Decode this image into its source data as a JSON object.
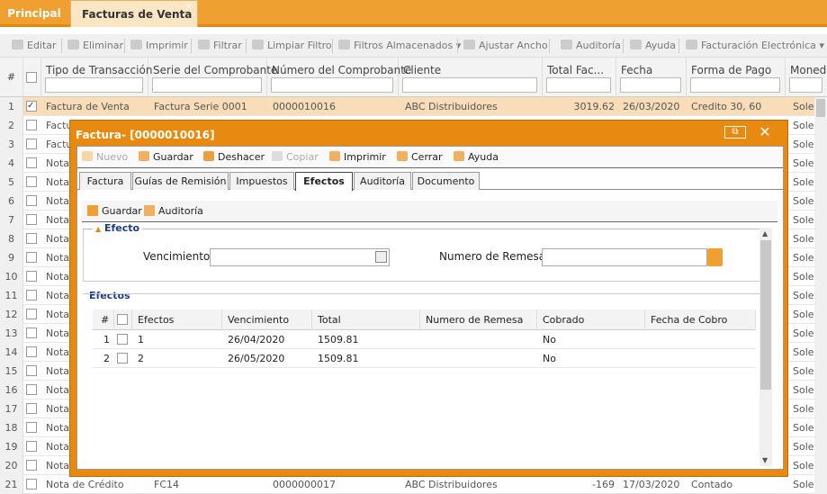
{
  "app_tabs": {
    "principal": "Principal",
    "facturas": "Facturas de Venta",
    "close": "×"
  },
  "toolbar": {
    "editar": "Editar",
    "eliminar": "Eliminar",
    "imprimir": "Imprimir",
    "filtrar": "Filtrar",
    "limpiar_filtro": "Limpiar Filtro",
    "filtros_almacenados": "Filtros Almacenados",
    "ajustar_ancho": "Ajustar Ancho",
    "auditoria": "Auditoría",
    "ayuda": "Ayuda",
    "facturacion_electronica": "Facturación Electrónica"
  },
  "grid": {
    "num_header": "#",
    "columns": [
      "Tipo de Transacción",
      "Serie del Comprobante",
      "Número del Comprobante",
      "Cliente",
      "Total Fac...",
      "Fecha",
      "Forma de Pago",
      "Moneda"
    ],
    "rows": [
      {
        "n": "1",
        "tipo": "Factura de Venta",
        "serie": "Factura Serie 0001",
        "numero": "0000010016",
        "cliente": "ABC Distribuidores",
        "total": "3019.62",
        "fecha": "26/03/2020",
        "forma": "Credito 30, 60",
        "moneda": "Soles",
        "checked": true
      },
      {
        "n": "2",
        "tipo": "Factu",
        "serie": "",
        "numero": "",
        "cliente": "",
        "total": "",
        "fecha": "",
        "forma": "",
        "moneda": "Soles",
        "checked": false
      },
      {
        "n": "3",
        "tipo": "Factu",
        "serie": "",
        "numero": "",
        "cliente": "",
        "total": "",
        "fecha": "",
        "forma": "",
        "moneda": "Soles",
        "checked": false
      },
      {
        "n": "4",
        "tipo": "Nota",
        "serie": "",
        "numero": "",
        "cliente": "",
        "total": "",
        "fecha": "",
        "forma": "",
        "moneda": "Soles",
        "checked": false
      },
      {
        "n": "5",
        "tipo": "Nota",
        "serie": "",
        "numero": "",
        "cliente": "",
        "total": "",
        "fecha": "",
        "forma": "",
        "moneda": "Soles",
        "checked": false
      },
      {
        "n": "6",
        "tipo": "Nota",
        "serie": "",
        "numero": "",
        "cliente": "",
        "total": "",
        "fecha": "",
        "forma": "",
        "moneda": "Soles",
        "checked": false
      },
      {
        "n": "7",
        "tipo": "Nota",
        "serie": "",
        "numero": "",
        "cliente": "",
        "total": "",
        "fecha": "",
        "forma": "",
        "moneda": "Soles",
        "checked": false
      },
      {
        "n": "8",
        "tipo": "Nota",
        "serie": "",
        "numero": "",
        "cliente": "",
        "total": "",
        "fecha": "",
        "forma": "",
        "moneda": "Soles",
        "checked": false
      },
      {
        "n": "9",
        "tipo": "Nota",
        "serie": "",
        "numero": "",
        "cliente": "",
        "total": "",
        "fecha": "",
        "forma": "",
        "moneda": "Soles",
        "checked": false
      },
      {
        "n": "10",
        "tipo": "Nota",
        "serie": "",
        "numero": "",
        "cliente": "",
        "total": "",
        "fecha": "",
        "forma": "",
        "moneda": "Soles",
        "checked": false
      },
      {
        "n": "11",
        "tipo": "Nota",
        "serie": "",
        "numero": "",
        "cliente": "",
        "total": "",
        "fecha": "",
        "forma": "",
        "moneda": "Soles",
        "checked": false
      },
      {
        "n": "12",
        "tipo": "Nota",
        "serie": "",
        "numero": "",
        "cliente": "",
        "total": "",
        "fecha": "",
        "forma": "",
        "moneda": "Soles",
        "checked": false
      },
      {
        "n": "13",
        "tipo": "Nota",
        "serie": "",
        "numero": "",
        "cliente": "",
        "total": "",
        "fecha": "",
        "forma": "",
        "moneda": "Soles",
        "checked": false
      },
      {
        "n": "14",
        "tipo": "Nota",
        "serie": "",
        "numero": "",
        "cliente": "",
        "total": "",
        "fecha": "",
        "forma": "",
        "moneda": "Soles",
        "checked": false
      },
      {
        "n": "15",
        "tipo": "Nota",
        "serie": "",
        "numero": "",
        "cliente": "",
        "total": "",
        "fecha": "",
        "forma": "",
        "moneda": "Soles",
        "checked": false
      },
      {
        "n": "16",
        "tipo": "Nota",
        "serie": "",
        "numero": "",
        "cliente": "",
        "total": "",
        "fecha": "",
        "forma": "",
        "moneda": "Soles",
        "checked": false
      },
      {
        "n": "17",
        "tipo": "Nota",
        "serie": "",
        "numero": "",
        "cliente": "",
        "total": "",
        "fecha": "",
        "forma": "",
        "moneda": "Soles",
        "checked": false
      },
      {
        "n": "18",
        "tipo": "Nota",
        "serie": "",
        "numero": "",
        "cliente": "",
        "total": "",
        "fecha": "",
        "forma": "",
        "moneda": "Soles",
        "checked": false
      },
      {
        "n": "19",
        "tipo": "Nota",
        "serie": "",
        "numero": "",
        "cliente": "",
        "total": "",
        "fecha": "",
        "forma": "",
        "moneda": "Soles",
        "checked": false
      },
      {
        "n": "20",
        "tipo": "Nota",
        "serie": "",
        "numero": "",
        "cliente": "",
        "total": "",
        "fecha": "",
        "forma": "",
        "moneda": "Soles",
        "checked": false
      },
      {
        "n": "21",
        "tipo": "Nota de Crédito",
        "serie": "FC14",
        "numero": "0000000017",
        "cliente": "ABC Distribuidores",
        "total": "-169",
        "fecha": "17/03/2020",
        "forma": "Contado",
        "moneda": "Soles",
        "checked": false
      }
    ]
  },
  "dialog": {
    "title": "Factura- [0000010016]",
    "restore": "⧉",
    "close": "✕",
    "toolbar": {
      "nuevo": "Nuevo",
      "guardar": "Guardar",
      "deshacer": "Deshacer",
      "copiar": "Copiar",
      "imprimir": "Imprimir",
      "cerrar": "Cerrar",
      "ayuda": "Ayuda"
    },
    "tabs": [
      "Factura",
      "Guías de Remisión",
      "Impuestos",
      "Efectos",
      "Auditoría",
      "Documento"
    ],
    "active_tab": "Efectos",
    "sub_toolbar": {
      "guardar": "Guardar",
      "auditoria": "Auditoría"
    },
    "efecto_section": {
      "legend": "Efecto",
      "vencimiento_label": "Vencimiento:",
      "vencimiento_value": "",
      "remesa_label": "Numero de Remesa:",
      "remesa_value": ""
    },
    "efectos_section": {
      "legend": "Efectos",
      "columns": [
        "#",
        "Efectos",
        "Vencimiento",
        "Total",
        "Numero de Remesa",
        "Cobrado",
        "Fecha de Cobro"
      ],
      "rows": [
        {
          "n": "1",
          "efecto": "1",
          "vencimiento": "26/04/2020",
          "total": "1509.81",
          "remesa": "",
          "cobrado": "No",
          "fecha_cobro": ""
        },
        {
          "n": "2",
          "efecto": "2",
          "vencimiento": "26/05/2020",
          "total": "1509.81",
          "remesa": "",
          "cobrado": "No",
          "fecha_cobro": ""
        }
      ]
    }
  },
  "colors": {
    "accent": "#e88a10",
    "tabbar": "#f0a030",
    "selected_row": "#f8ddb8",
    "legend": "#1a3a8a"
  }
}
